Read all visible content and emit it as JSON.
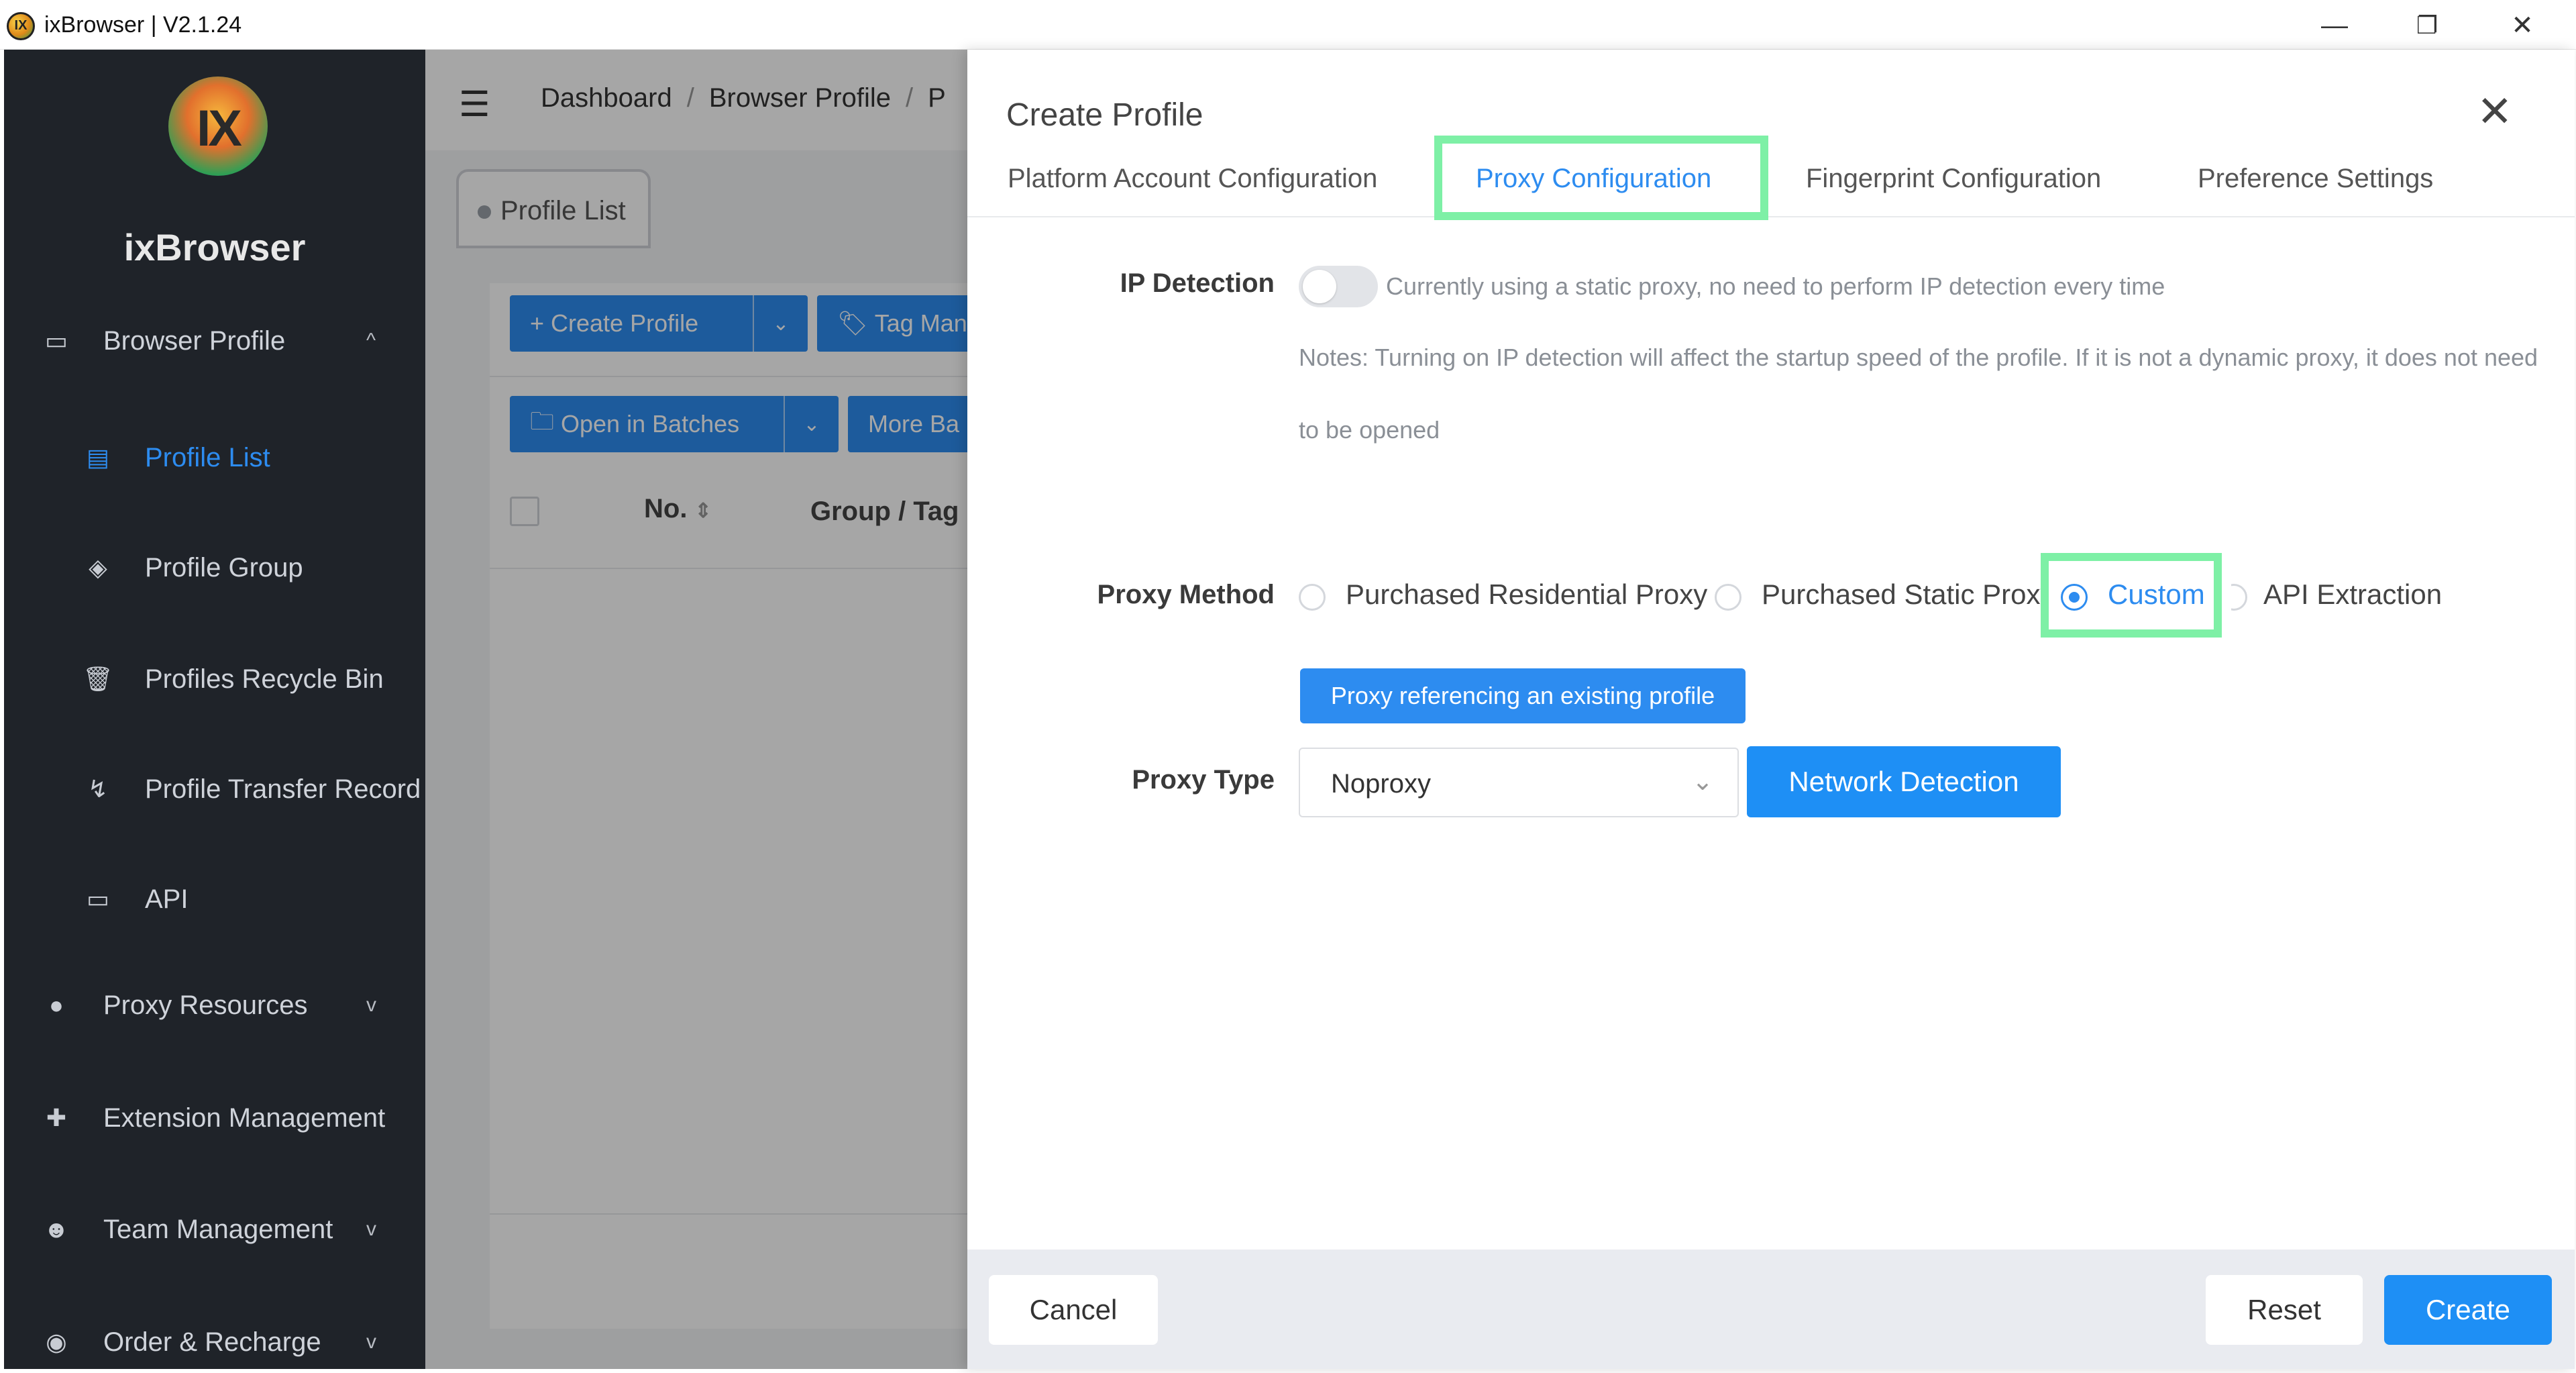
{
  "window": {
    "title": "ixBrowser | V2.1.24",
    "app_icon_text": "IX",
    "minimize": "—",
    "restore": "❐",
    "close": "✕"
  },
  "sidebar": {
    "logo_text": "IX",
    "brand": "ixBrowser",
    "items": [
      {
        "label": "Browser Profile",
        "icon": "browser-icon",
        "chevron": "^"
      },
      {
        "label": "Profile List",
        "icon": "list-icon"
      },
      {
        "label": "Profile Group",
        "icon": "layers-icon"
      },
      {
        "label": "Profiles Recycle Bin",
        "icon": "trash-icon"
      },
      {
        "label": "Profile Transfer Record",
        "icon": "transfer-icon"
      },
      {
        "label": "API",
        "icon": "api-icon"
      },
      {
        "label": "Proxy Resources",
        "icon": "globe-icon",
        "chevron": "v"
      },
      {
        "label": "Extension Management",
        "icon": "puzzle-icon"
      },
      {
        "label": "Team Management",
        "icon": "team-icon",
        "chevron": "v"
      },
      {
        "label": "Order & Recharge",
        "icon": "coin-icon",
        "chevron": "v"
      }
    ]
  },
  "main": {
    "breadcrumb": [
      "Dashboard",
      "Browser Profile",
      "P"
    ],
    "tab": "Profile List",
    "create_profile": "+ Create Profile",
    "tag_manage": "Tag Man",
    "open_batches": "Open in Batches",
    "more_batch": "More Ba",
    "col_no": "No.",
    "col_group": "Group / Tag"
  },
  "drawer": {
    "title": "Create Profile",
    "close": "✕",
    "tabs": [
      {
        "label": "Platform Account Configuration"
      },
      {
        "label": "Proxy Configuration"
      },
      {
        "label": "Fingerprint Configuration"
      },
      {
        "label": "Preference Settings"
      }
    ],
    "ip_detection": {
      "label": "IP Detection",
      "hint": "Currently using a static proxy, no need to perform IP detection every time",
      "note_line1": "Notes: Turning on IP detection will affect the startup speed of the profile. If it is not a dynamic proxy, it does not need",
      "note_line2": "to be opened",
      "enabled": false
    },
    "proxy_method": {
      "label": "Proxy Method",
      "options": [
        "Purchased Residential Proxy",
        "Purchased Static Proxy",
        "Custom",
        "API Extraction"
      ],
      "selected": "Custom"
    },
    "reference_button": "Proxy referencing an existing profile",
    "proxy_type": {
      "label": "Proxy Type",
      "value": "Noproxy"
    },
    "network_detection": "Network Detection",
    "footer": {
      "cancel": "Cancel",
      "reset": "Reset",
      "create": "Create"
    }
  },
  "colors": {
    "accent": "#2d8cf0",
    "sidebar_bg": "#1f2329",
    "highlight": "#7ef0a6"
  }
}
